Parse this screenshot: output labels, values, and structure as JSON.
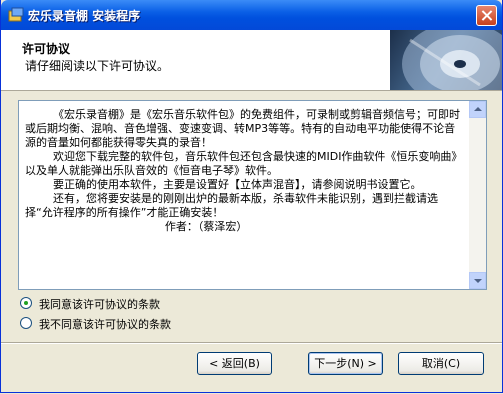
{
  "window": {
    "title": "宏乐录音棚 安装程序"
  },
  "header": {
    "title": "许可协议",
    "subtitle": "请仔细阅读以下许可协议。"
  },
  "license": {
    "text": "        《宏乐录音棚》是《宏乐音乐软件包》的免费组件，可录制或剪辑音频信号；可即时或后期均衡、混响、音色增强、变速变调、转MP3等等。特有的自动电平功能使得不论音源的音量如何都能获得零失真的录音！\n        欢迎您下载完整的软件包，音乐软件包还包含最快速的MIDI作曲软件《恒乐变响曲》以及单人就能弹出乐队音效的《恒音电子琴》软件。\n        要正确的使用本软件，主要是设置好【立体声混音】，请参阅说明书设置它。\n        还有，您将要安装是的刚刚出炉的最新本版，杀毒软件未能识别，遇到拦截请选择“允许程序的所有操作”才能正确安装！\n                                        作者：（蔡泽宏）"
  },
  "options": {
    "accept": "我同意该许可协议的条款",
    "decline": "我不同意该许可协议的条款",
    "selected": "accept"
  },
  "buttons": {
    "back": "< 返回(B)",
    "next": "下一步(N) >",
    "cancel": "取消(C)"
  }
}
